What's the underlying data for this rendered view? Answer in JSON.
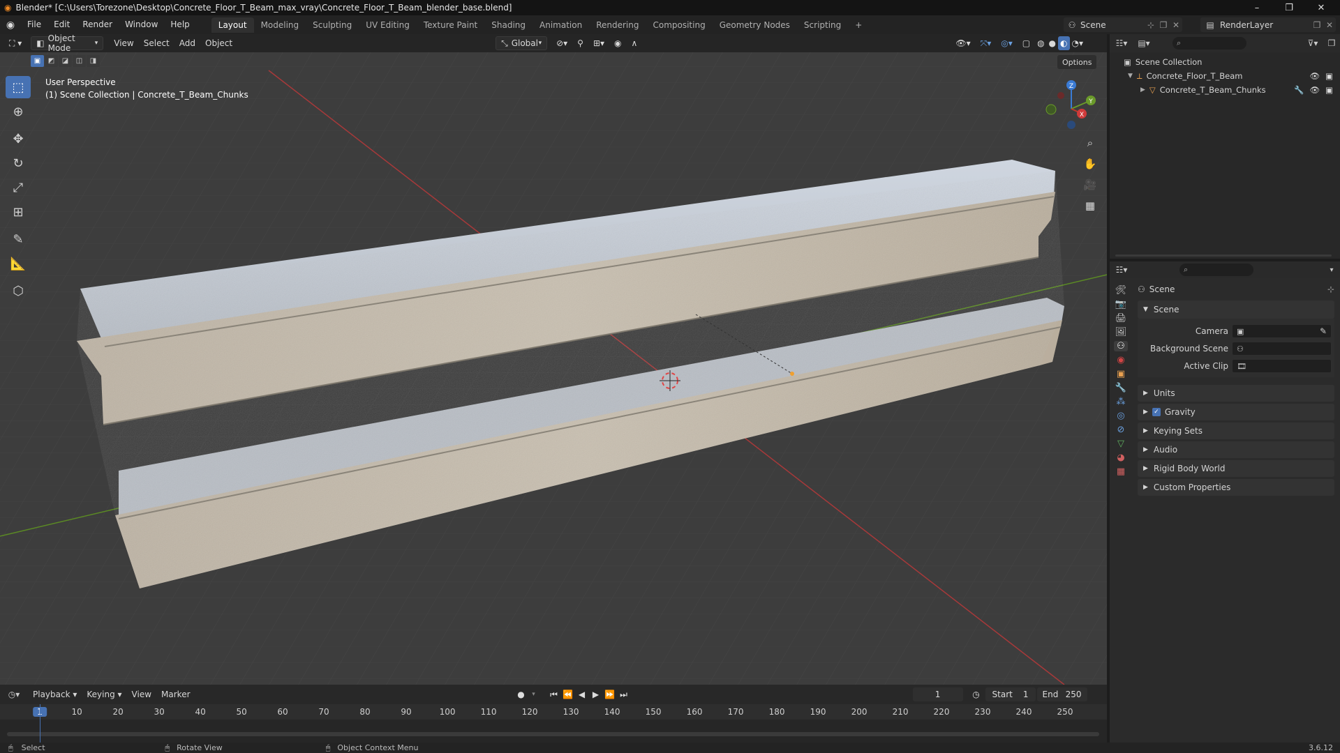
{
  "titlebar": {
    "title": "Blender* [C:\\Users\\Torezone\\Desktop\\Concrete_Floor_T_Beam_max_vray\\Concrete_Floor_T_Beam_blender_base.blend]",
    "minimize": "–",
    "restore": "❐",
    "close": "✕"
  },
  "menubar": {
    "items": [
      "File",
      "Edit",
      "Render",
      "Window",
      "Help"
    ],
    "workspaces": [
      "Layout",
      "Modeling",
      "Sculpting",
      "UV Editing",
      "Texture Paint",
      "Shading",
      "Animation",
      "Rendering",
      "Compositing",
      "Geometry Nodes",
      "Scripting"
    ],
    "add_tab": "+",
    "scene_name": "Scene",
    "render_layer": "RenderLayer"
  },
  "viewport": {
    "mode": "Object Mode",
    "menus": [
      "View",
      "Select",
      "Add",
      "Object"
    ],
    "orientation": "Global",
    "options": "Options",
    "overlay_line1": "User Perspective",
    "overlay_line2": "(1) Scene Collection | Concrete_T_Beam_Chunks",
    "gizmo": {
      "x": "X",
      "y": "Y",
      "z": "Z"
    }
  },
  "outliner": {
    "root": "Scene Collection",
    "items": [
      {
        "label": "Concrete_Floor_T_Beam"
      },
      {
        "label": "Concrete_T_Beam_Chunks"
      }
    ]
  },
  "properties": {
    "context": "Scene",
    "section": "Scene",
    "fields": {
      "camera": "Camera",
      "background_scene": "Background Scene",
      "active_clip": "Active Clip"
    },
    "panels": [
      "Units",
      "Gravity",
      "Keying Sets",
      "Audio",
      "Rigid Body World",
      "Custom Properties"
    ]
  },
  "timeline": {
    "menus": [
      "Playback",
      "Keying",
      "View",
      "Marker"
    ],
    "current_frame": "1",
    "start_label": "Start",
    "start": "1",
    "end_label": "End",
    "end": "250",
    "ticks": [
      "1",
      "10",
      "20",
      "30",
      "40",
      "50",
      "60",
      "70",
      "80",
      "90",
      "100",
      "110",
      "120",
      "130",
      "140",
      "150",
      "160",
      "170",
      "180",
      "190",
      "200",
      "210",
      "220",
      "230",
      "240",
      "250"
    ]
  },
  "statusbar": {
    "select": "Select",
    "rotate": "Rotate View",
    "context_menu": "Object Context Menu",
    "version": "3.6.12"
  },
  "colors": {
    "accent": "#4772b3",
    "x_axis": "#c0392b",
    "y_axis": "#6a9a2a",
    "z_axis": "#3a7bd5"
  }
}
